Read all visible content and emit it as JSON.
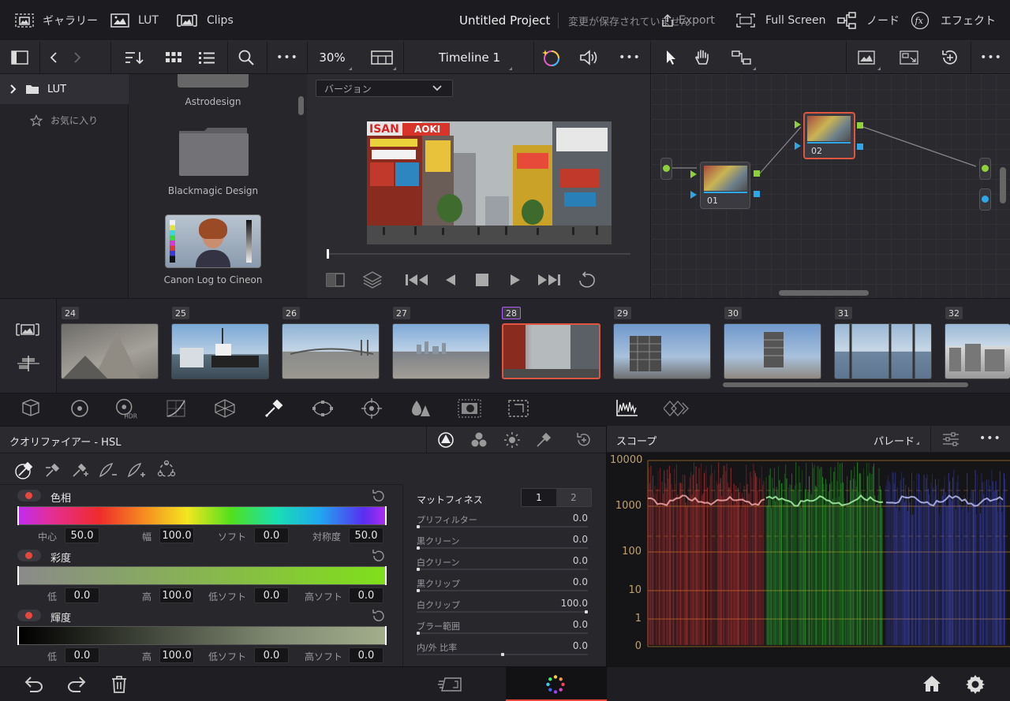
{
  "topbar": {
    "gallery_label": "ギャラリー",
    "lut_label": "LUT",
    "clips_label": "Clips",
    "project_title": "Untitled Project",
    "save_status": "変更が保存されていません",
    "export_label": "Export",
    "fullscreen_label": "Full Screen",
    "node_label": "ノード",
    "effects_label": "エフェクト"
  },
  "toolbar": {
    "zoom": "30%",
    "timeline": "Timeline 1",
    "more": "•••"
  },
  "lut_panel": {
    "root_folder": "LUT",
    "favorites": "お気に入り"
  },
  "media": {
    "items": [
      "Astrodesign",
      "Blackmagic Design",
      "Canon Log to Cineon"
    ]
  },
  "viewer": {
    "version_select": "バージョン"
  },
  "nodes": {
    "node1": "01",
    "node2": "02"
  },
  "clips": {
    "numbers": [
      "24",
      "25",
      "26",
      "27",
      "28",
      "29",
      "30",
      "31",
      "32"
    ],
    "selected": "28"
  },
  "hsl": {
    "title": "クオリファイアー - HSL",
    "hue": {
      "label": "色相",
      "center_label": "中心",
      "center": "50.0",
      "width_label": "幅",
      "width": "100.0",
      "soft_label": "ソフト",
      "soft": "0.0",
      "sym_label": "対称度",
      "sym": "50.0"
    },
    "sat": {
      "label": "彩度",
      "low_label": "低",
      "low": "0.0",
      "high_label": "高",
      "high": "100.0",
      "lsoft_label": "低ソフト",
      "lsoft": "0.0",
      "hsoft_label": "高ソフト",
      "hsoft": "0.0"
    },
    "lum": {
      "label": "輝度",
      "low_label": "低",
      "low": "0.0",
      "high_label": "高",
      "high": "100.0",
      "lsoft_label": "低ソフト",
      "lsoft": "0.0",
      "hsoft_label": "高ソフト",
      "hsoft": "0.0"
    }
  },
  "matte": {
    "title": "マットフィネス",
    "tab1": "1",
    "tab2": "2",
    "params": [
      {
        "name": "プリフィルター",
        "value": "0.0",
        "level": 0
      },
      {
        "name": "黒クリーン",
        "value": "0.0",
        "level": 0
      },
      {
        "name": "白クリーン",
        "value": "0.0",
        "level": 0
      },
      {
        "name": "黒クリップ",
        "value": "0.0",
        "level": 0
      },
      {
        "name": "白クリップ",
        "value": "100.0",
        "level": 1
      },
      {
        "name": "ブラー範囲",
        "value": "0.0",
        "level": 0
      },
      {
        "name": "内/外 比率",
        "value": "0.0",
        "level": 0.5
      }
    ]
  },
  "scope": {
    "title": "スコープ",
    "mode": "パレード",
    "ticks": [
      "10000",
      "1000",
      "100",
      "10",
      "1",
      "0"
    ]
  },
  "colors": {
    "accent_red": "#e8473d",
    "selection": "#e0553f",
    "node_green": "#8ed13a",
    "node_blue": "#2fa7e6"
  }
}
